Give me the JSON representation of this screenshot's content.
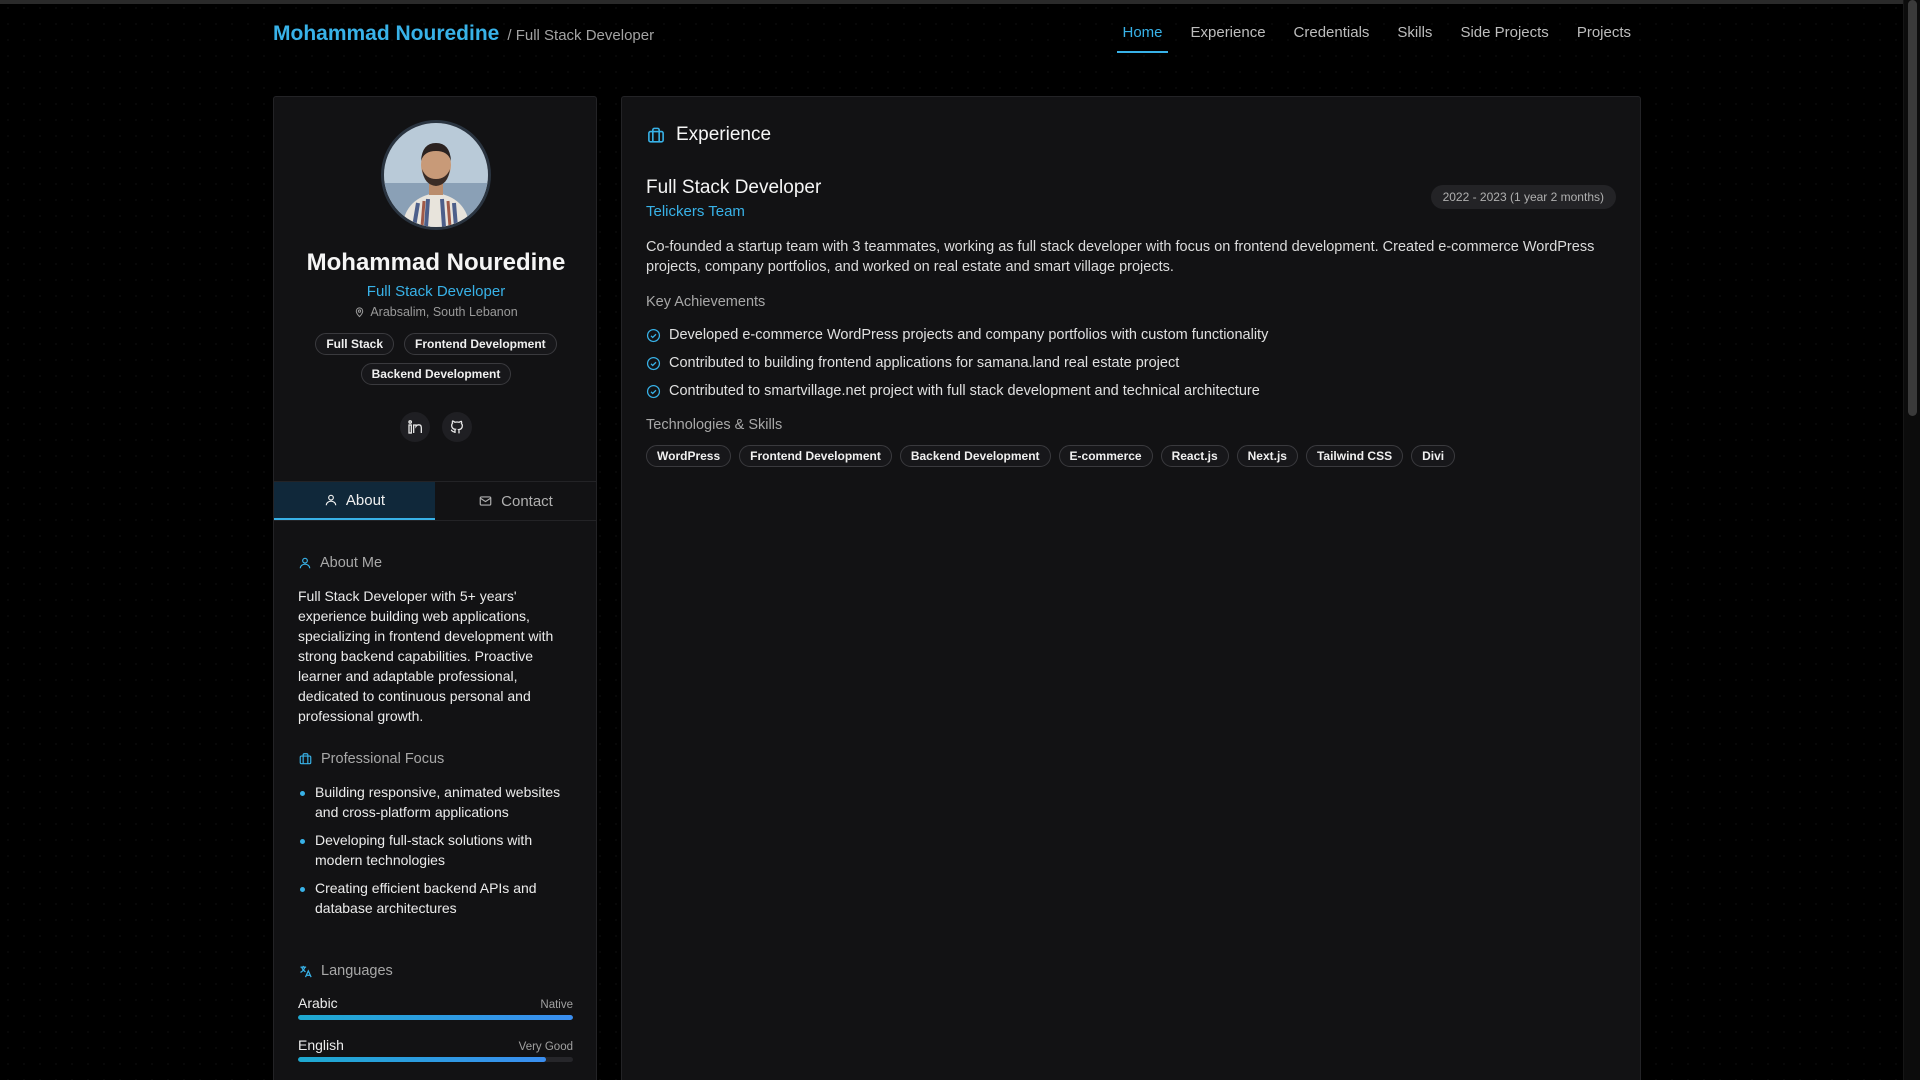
{
  "header": {
    "brand_name": "Mohammad Nouredine",
    "brand_subtitle": "/ Full Stack Developer",
    "nav": [
      {
        "label": "Home",
        "active": true
      },
      {
        "label": "Experience"
      },
      {
        "label": "Credentials"
      },
      {
        "label": "Skills"
      },
      {
        "label": "Side Projects"
      },
      {
        "label": "Projects"
      }
    ]
  },
  "profile": {
    "name": "Mohammad Nouredine",
    "title": "Full Stack Developer",
    "location": "Arabsalim, South Lebanon",
    "tags": [
      "Full Stack",
      "Frontend Development",
      "Backend Development"
    ],
    "socials": [
      {
        "icon": "linkedin-icon"
      },
      {
        "icon": "github-icon"
      }
    ]
  },
  "tabs": {
    "about": "About",
    "contact": "Contact"
  },
  "about": {
    "heading": "About Me",
    "text": "Full Stack Developer with 5+ years' experience building web applications, specializing in frontend development with strong backend capabilities. Proactive learner and adaptable professional, dedicated to continuous personal and professional growth.",
    "focus_heading": "Professional Focus",
    "focus": [
      "Building responsive, animated websites and cross-platform applications",
      "Developing full-stack solutions with modern technologies",
      "Creating efficient backend APIs and database architectures"
    ],
    "languages_heading": "Languages",
    "languages": [
      {
        "name": "Arabic",
        "level": "Native",
        "fraction": 1.0
      },
      {
        "name": "English",
        "level": "Very Good",
        "fraction": 0.9
      }
    ]
  },
  "experience": {
    "heading": "Experience",
    "job_title": "Full Stack Developer",
    "company": "Telickers Team",
    "dates": "2022 - 2023 (1 year 2 months)",
    "description": "Co-founded a startup team with 3 teammates, working as full stack developer with focus on frontend development. Created e-commerce WordPress projects, company portfolios, and worked on real estate and smart village projects.",
    "achievements_heading": "Key Achievements",
    "achievements": [
      "Developed e-commerce WordPress projects and company portfolios with custom functionality",
      "Contributed to building frontend applications for samana.land real estate project",
      "Contributed to smartvillage.net project with full stack development and technical architecture"
    ],
    "tech_heading": "Technologies & Skills",
    "tech": [
      "WordPress",
      "Frontend Development",
      "Backend Development",
      "E-commerce",
      "React.js",
      "Next.js",
      "Tailwind CSS",
      "Divi"
    ]
  },
  "colors": {
    "accent": "#38b2e8",
    "background": "#000000",
    "card": "#121214"
  }
}
